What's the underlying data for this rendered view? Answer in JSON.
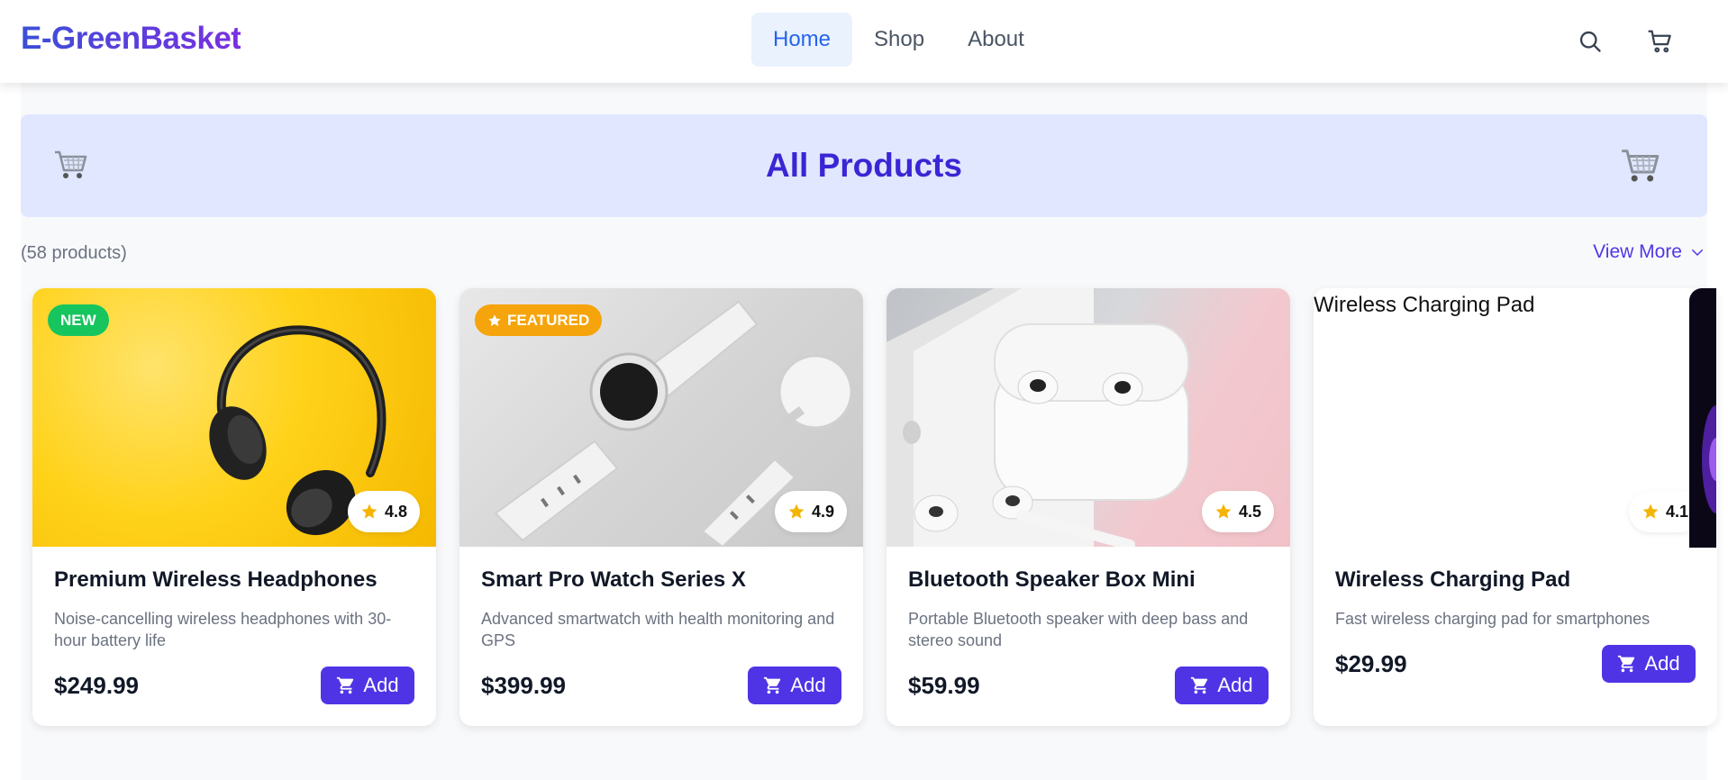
{
  "header": {
    "logo": "E-GreenBasket",
    "nav": [
      "Home",
      "Shop",
      "About"
    ],
    "active_nav": "Home",
    "icons": [
      "search-icon",
      "cart-icon"
    ]
  },
  "banner": {
    "title": "All Products",
    "icons": [
      "shopping-cart-emoji",
      "shopping-cart-emoji"
    ]
  },
  "listing": {
    "count_text": "(58 products)",
    "view_more": "View More"
  },
  "products": [
    {
      "name": "Premium Wireless Headphones",
      "description": "Noise-cancelling wireless headphones with 30-hour battery life",
      "price": "$249.99",
      "rating": "4.8",
      "badge": "NEW",
      "add_label": "Add"
    },
    {
      "name": "Smart Pro Watch Series X",
      "description": "Advanced smartwatch with health monitoring and GPS",
      "price": "$399.99",
      "rating": "4.9",
      "badge": "FEATURED",
      "add_label": "Add"
    },
    {
      "name": "Bluetooth Speaker Box Mini",
      "description": "Portable Bluetooth speaker with deep bass and stereo sound",
      "price": "$59.99",
      "rating": "4.5",
      "add_label": "Add"
    },
    {
      "name": "Wireless Charging Pad",
      "description": "Fast wireless charging pad for smartphones",
      "price": "$29.99",
      "rating": "4.1",
      "image_alt": "Wireless Charging Pad",
      "add_label": "Add"
    }
  ],
  "colors": {
    "accent": "#4f34e6",
    "banner_bg": "#e0e7ff",
    "badge_new": "#16c55e",
    "badge_featured": "#f5a40b",
    "nav_active_bg": "#eaf2fe"
  }
}
